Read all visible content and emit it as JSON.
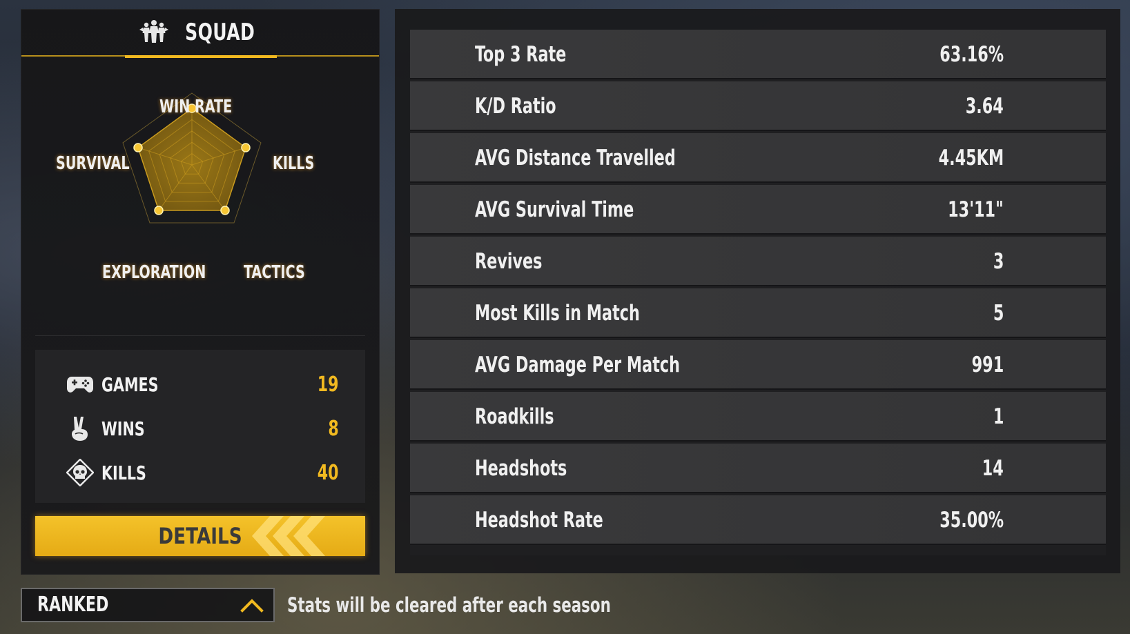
{
  "squad": {
    "title": "SQUAD",
    "icon": "squad-group-icon"
  },
  "radar": {
    "labels": {
      "win_rate": "WIN RATE",
      "kills": "KILLS",
      "tactics": "TACTICS",
      "exploration": "EXPLORATION",
      "survival": "SURVIVAL"
    },
    "accent_color": "#f1b920"
  },
  "summary": {
    "items": [
      {
        "icon": "gamepad-icon",
        "label": "GAMES",
        "value": "19"
      },
      {
        "icon": "peace-hand-icon",
        "label": "WINS",
        "value": "8"
      },
      {
        "icon": "skull-icon",
        "label": "KILLS",
        "value": "40"
      }
    ],
    "value_color": "#f1b920"
  },
  "details_button": {
    "label": "DETAILS"
  },
  "stats": [
    {
      "label": "Top 3 Rate",
      "value": "63.16%"
    },
    {
      "label": "K/D Ratio",
      "value": "3.64"
    },
    {
      "label": "AVG Distance Travelled",
      "value": "4.45KM"
    },
    {
      "label": "AVG Survival Time",
      "value": "13'11\""
    },
    {
      "label": "Revives",
      "value": "3"
    },
    {
      "label": "Most Kills in Match",
      "value": "5"
    },
    {
      "label": "AVG Damage Per Match",
      "value": "991"
    },
    {
      "label": "Roadkills",
      "value": "1"
    },
    {
      "label": "Headshots",
      "value": "14"
    },
    {
      "label": "Headshot Rate",
      "value": "35.00%"
    }
  ],
  "mode_dropdown": {
    "selected": "RANKED",
    "icon": "chevron-up-icon"
  },
  "season_note": "Stats will be cleared after each season"
}
